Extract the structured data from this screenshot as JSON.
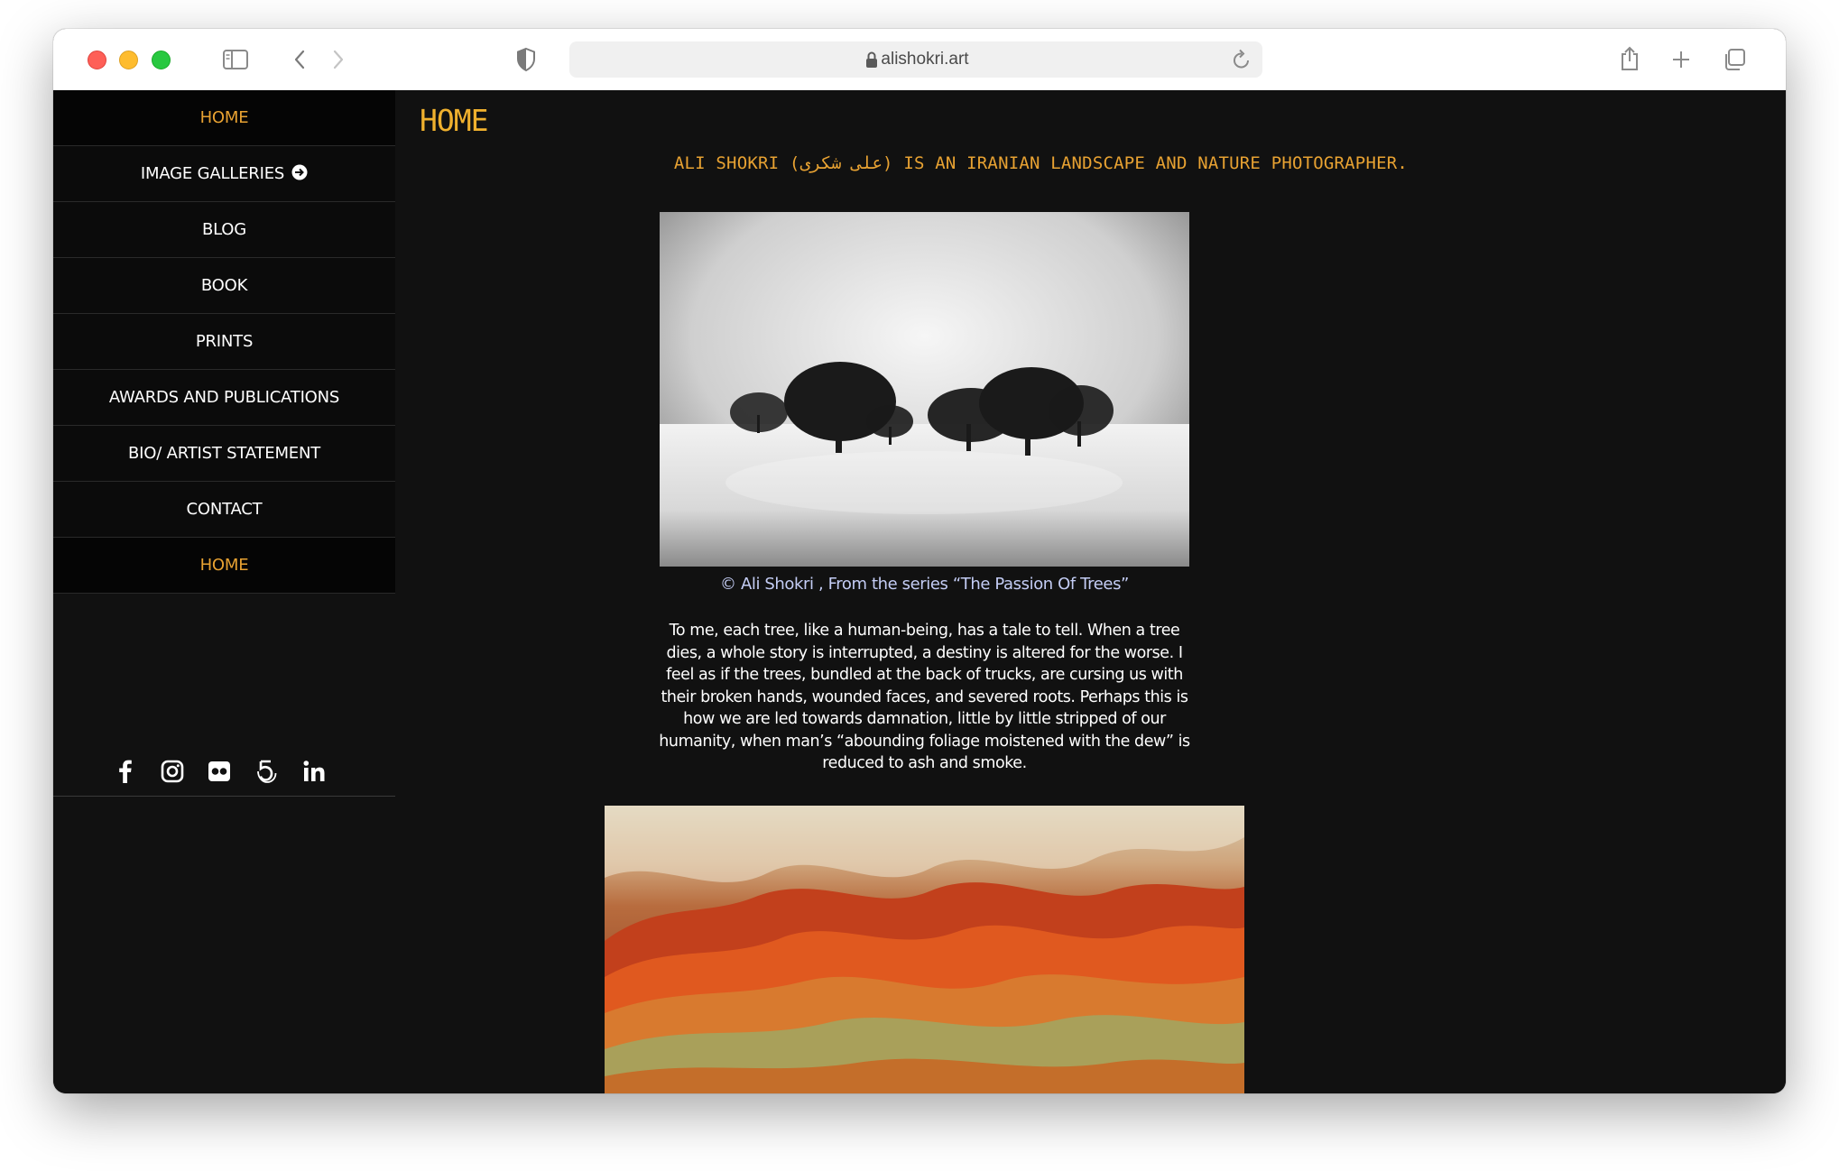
{
  "browser": {
    "url": "alishokri.art",
    "icons": [
      "sidebar-toggle-icon",
      "back-icon",
      "forward-icon",
      "shield-icon",
      "lock-icon",
      "reload-icon",
      "share-icon",
      "new-tab-icon",
      "tabs-overview-icon"
    ]
  },
  "sidebar": {
    "items": [
      {
        "label": "HOME",
        "active": true
      },
      {
        "label": "IMAGE GALLERIES",
        "active": false,
        "icon": "arrow-right-circle-icon"
      },
      {
        "label": "BLOG",
        "active": false
      },
      {
        "label": "BOOK",
        "active": false
      },
      {
        "label": "PRINTS",
        "active": false
      },
      {
        "label": "AWARDS AND PUBLICATIONS",
        "active": false
      },
      {
        "label": "BIO/ ARTIST STATEMENT",
        "active": false
      },
      {
        "label": "CONTACT",
        "active": false
      },
      {
        "label": "HOME",
        "active": true
      }
    ],
    "social": [
      "facebook-icon",
      "instagram-icon",
      "flickr-icon",
      "500px-icon",
      "linkedin-icon"
    ]
  },
  "main": {
    "title": "HOME",
    "tagline": "ALI SHOKRI (علی شکری) IS AN IRANIAN LANDSCAPE AND NATURE PHOTOGRAPHER.",
    "caption": "© Ali Shokri , From the series “The Passion Of Trees”",
    "body": "To me, each tree, like a human-being, has a tale to tell. When a tree dies, a whole story is interrupted, a destiny is altered for the worse. I feel as if the trees, bundled at the back of trucks, are cursing us with their broken hands, wounded faces, and severed roots. Perhaps this is how we are led towards damnation, little by little stripped of our humanity, when man’s “abounding foliage moistened with the dew” is reduced to ash and smoke."
  },
  "colors": {
    "accent": "#e8a232",
    "caption": "#c4cdf5",
    "background": "#111111"
  }
}
